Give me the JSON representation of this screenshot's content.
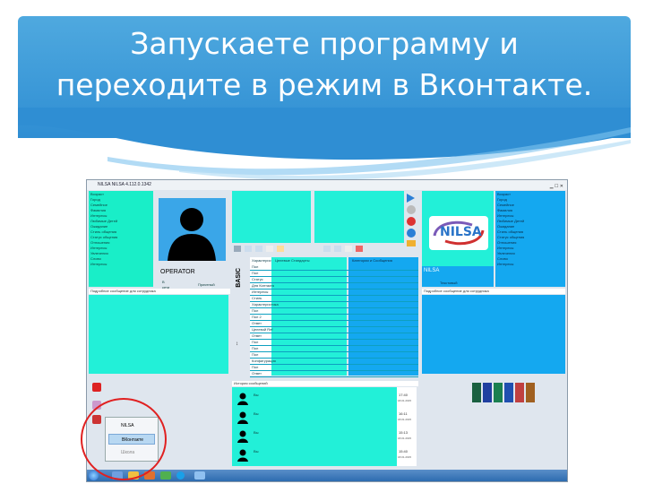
{
  "slide": {
    "title_line1": "Запускаете программу и",
    "title_line2": "переходите в режим в Вконтакте."
  },
  "window": {
    "title": "NILSA   NILSA   4.112.0.1342"
  },
  "left_panel": {
    "items": [
      "Возраст",
      "Город",
      "Семейное",
      "Фамилия",
      "Интересы",
      "Любимые Детей",
      "Ожидание",
      "Стиль общения",
      "Статус общения",
      "Отношения",
      "Интересы",
      "Увлечения",
      "Слово",
      "Интересы"
    ],
    "status_label": "В сети",
    "status_value": "Приятный",
    "section_label": "Подробное сообщение для сотрудника"
  },
  "operator": {
    "name": "OPERATOR"
  },
  "center_table": {
    "header1": "Характеристика",
    "header2": "Целевые Стандарты",
    "header3": "Категории и Сообщения",
    "rows": [
      "Пол",
      "Пол",
      "Статус",
      "Для Контакта",
      "Интересы",
      "Стиль",
      "Характеристика",
      "Пол",
      "Пол 2",
      "Ответ",
      "Целевой Ref",
      "Ответ",
      "Пол",
      "Пол",
      "Пол",
      "Конфигурация",
      "Пол",
      "Ответ"
    ]
  },
  "right_panel": {
    "logo": "NILSA",
    "caption": "NILSA",
    "status_value": "Текстовый",
    "items": [
      "Возраст",
      "Город",
      "Семейное",
      "Фамилия",
      "Интересы",
      "Любимые Детей",
      "Ожидание",
      "Стиль общения",
      "Статус общения",
      "Отношения",
      "Интересы",
      "Увлечения",
      "Слово",
      "Интересы"
    ],
    "section_label": "Подробное сообщение для сотрудника"
  },
  "messages": {
    "header": "История сообщений",
    "rows": [
      {
        "label": "Вы",
        "time": "17:40",
        "date": "18.01.2015"
      },
      {
        "label": "Вы",
        "time": "16:11",
        "date": "18.01.2015"
      },
      {
        "label": "Вы",
        "time": "15:13",
        "date": "18.01.2015"
      },
      {
        "label": "Вы",
        "time": "15:40",
        "date": "18.01.2015"
      }
    ]
  },
  "popup": {
    "items": [
      "NILSA",
      "ВКонтакте",
      "Школа"
    ]
  },
  "colors": {
    "header_blue": "#3a9ad9",
    "panel_green": "#19eec8",
    "panel_blue": "#14a8f0",
    "highlight_red": "#e02020"
  }
}
